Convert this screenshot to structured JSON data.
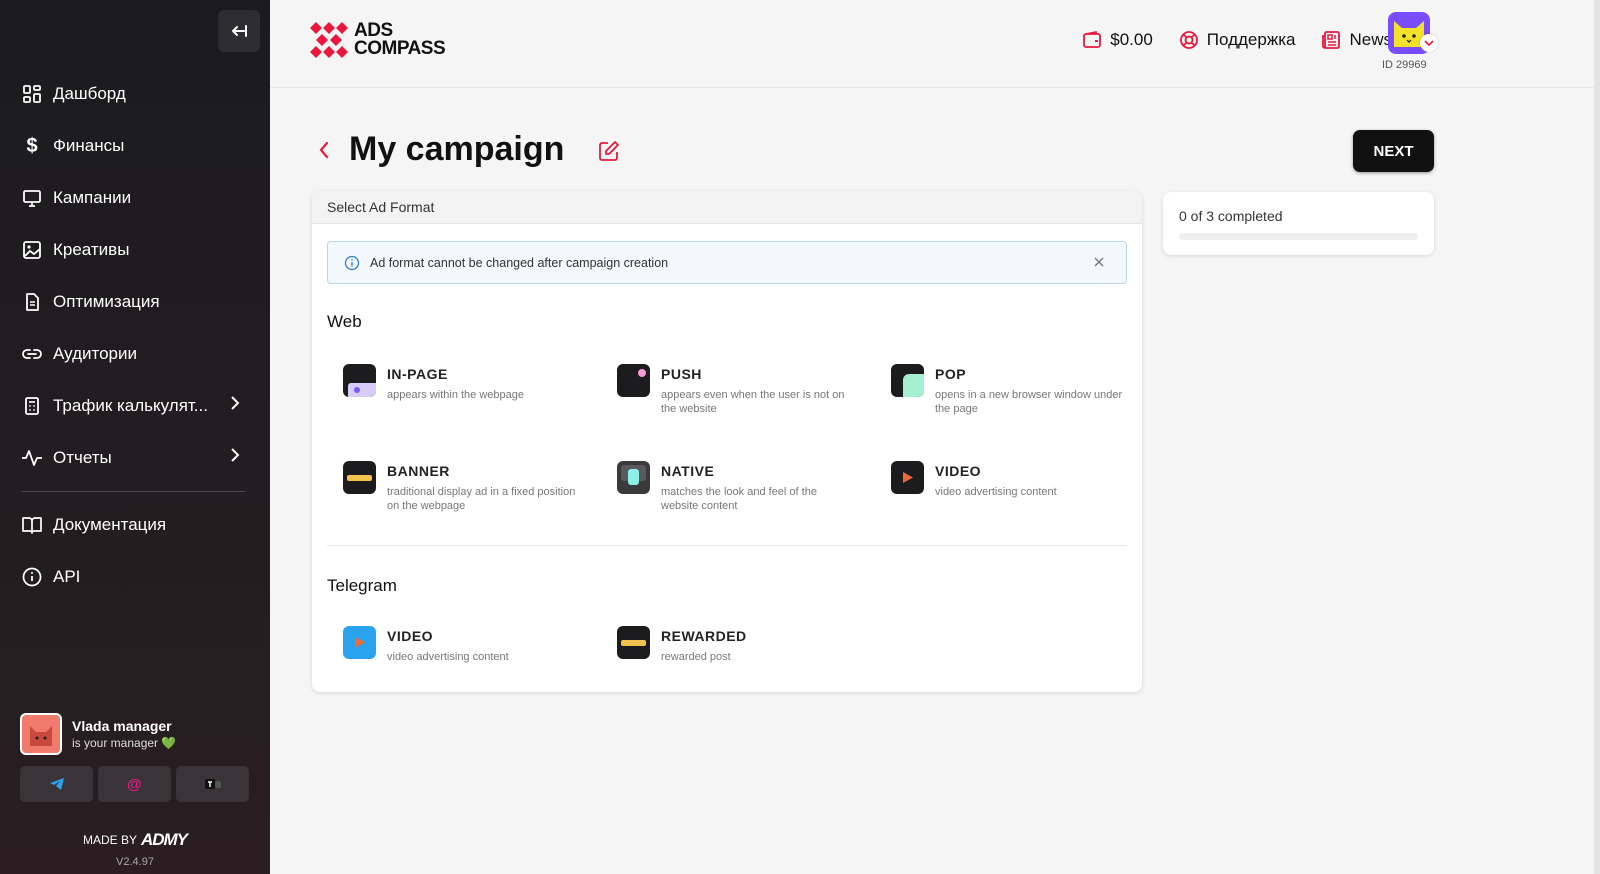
{
  "sidebar": {
    "items": [
      {
        "label": "Дашборд",
        "icon": "dashboard-icon"
      },
      {
        "label": "Финансы",
        "icon": "dollar-icon"
      },
      {
        "label": "Кампании",
        "icon": "monitor-icon"
      },
      {
        "label": "Креативы",
        "icon": "image-icon"
      },
      {
        "label": "Оптимизация",
        "icon": "document-icon"
      },
      {
        "label": "Аудитории",
        "icon": "link-icon"
      },
      {
        "label": "Трафик калькулят...",
        "icon": "calculator-icon"
      },
      {
        "label": "Отчеты",
        "icon": "activity-icon"
      }
    ],
    "bottom_items": [
      {
        "label": "Документация",
        "icon": "book-icon"
      },
      {
        "label": "API",
        "icon": "info-icon"
      }
    ],
    "manager": {
      "name": "Vlada manager",
      "subtitle": "is your manager 💚"
    },
    "made_by": "MADE BY",
    "made_by_brand": "ADMY",
    "version": "V2.4.97"
  },
  "header": {
    "logo_line1": "ADS",
    "logo_line2": "COMPASS",
    "balance": "$0.00",
    "support": "Поддержка",
    "news": "News",
    "user_id": "ID 29969"
  },
  "page": {
    "title": "My campaign",
    "next": "NEXT"
  },
  "format_card": {
    "header": "Select Ad Format",
    "alert": "Ad format cannot be changed after campaign creation",
    "web_title": "Web",
    "web_formats": [
      {
        "name": "IN-PAGE",
        "desc": "appears within the webpage"
      },
      {
        "name": "PUSH",
        "desc": "appears even when the user is not on the website"
      },
      {
        "name": "POP",
        "desc": "opens in a new browser window under the page"
      },
      {
        "name": "BANNER",
        "desc": "traditional display ad in a fixed position on the webpage"
      },
      {
        "name": "NATIVE",
        "desc": "matches the look and feel of the website content"
      },
      {
        "name": "VIDEO",
        "desc": "video advertising content"
      }
    ],
    "telegram_title": "Telegram",
    "telegram_formats": [
      {
        "name": "VIDEO",
        "desc": "video advertising content"
      },
      {
        "name": "REWARDED",
        "desc": "rewarded post"
      }
    ]
  },
  "progress": {
    "text": "0 of 3 completed",
    "fraction": 0
  },
  "colors": {
    "accent": "#e8193c",
    "sidebar_bg": "#1b1b1e",
    "alert_bg": "#f2f8fd"
  }
}
